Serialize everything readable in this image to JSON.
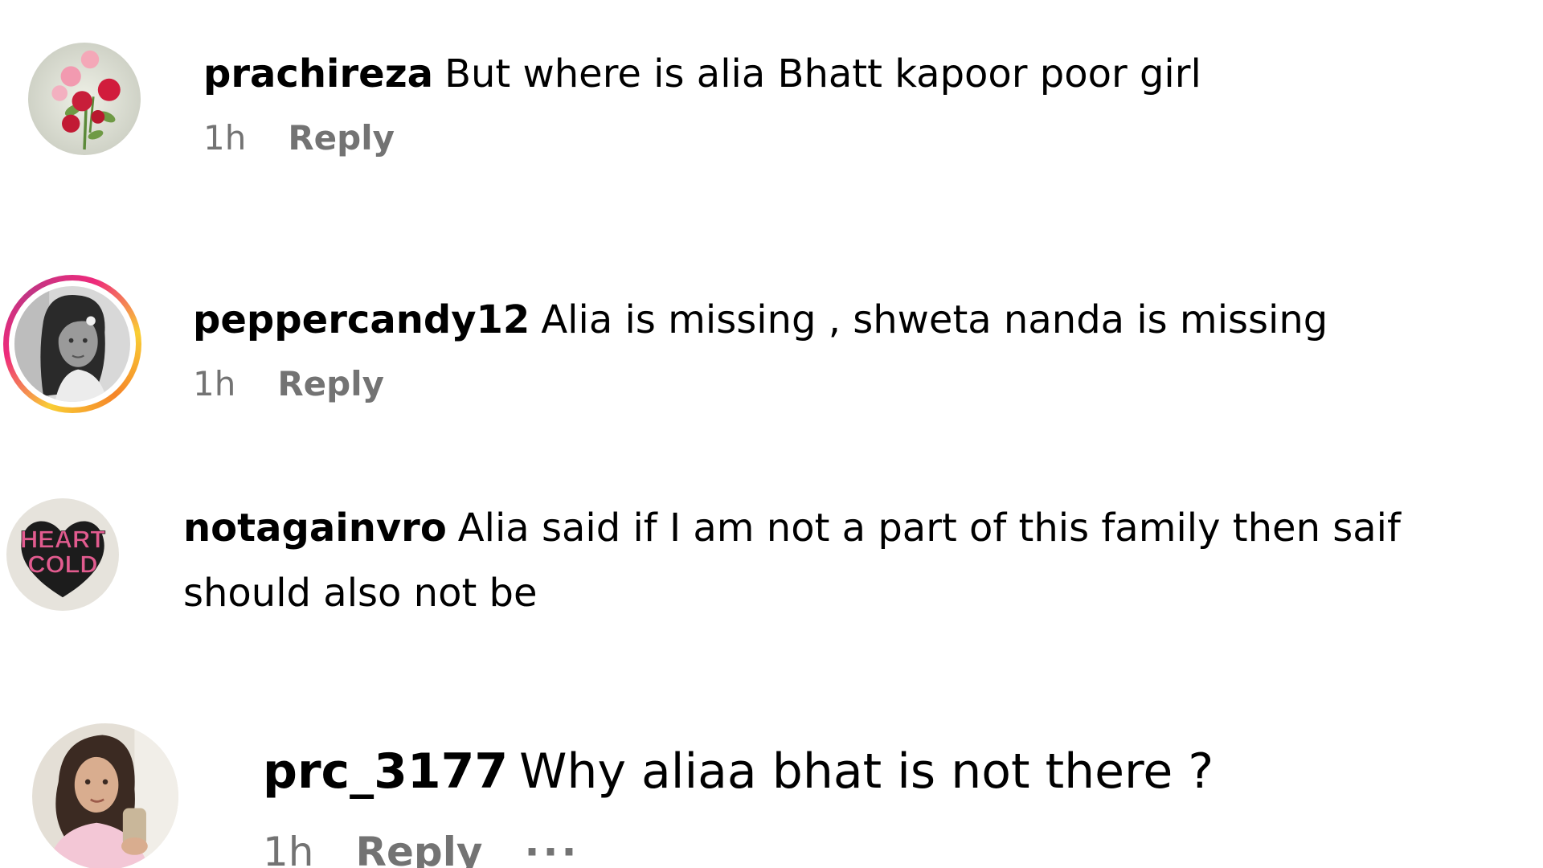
{
  "comments": [
    {
      "username": "prachireza",
      "text": "But where is alia Bhatt kapoor poor girl",
      "time": "1h",
      "reply_label": "Reply",
      "avatar_icon": "rose-flowers-avatar",
      "has_story_ring": false
    },
    {
      "username": "peppercandy12",
      "text": "Alia is missing , shweta nanda is missing",
      "time": "1h",
      "reply_label": "Reply",
      "avatar_icon": "woman-portrait-bw-avatar",
      "has_story_ring": true
    },
    {
      "username": "notagainvro",
      "text_line1": "Alia said if I am not a part of this family then saif",
      "text_line2": "should also not be",
      "avatar_icon": "heart-cold-avatar",
      "avatar_text_1": "HEART",
      "avatar_text_2": "COLD",
      "has_story_ring": false
    },
    {
      "username": "prc_3177",
      "text": "Why aliaa bhat is not there ?",
      "time": "1h",
      "reply_label": "Reply",
      "more_label": "···",
      "avatar_icon": "woman-selfie-avatar",
      "has_story_ring": false
    }
  ],
  "colors": {
    "text": "#000000",
    "meta": "#737373",
    "story_ring": "#ee2a7b"
  }
}
